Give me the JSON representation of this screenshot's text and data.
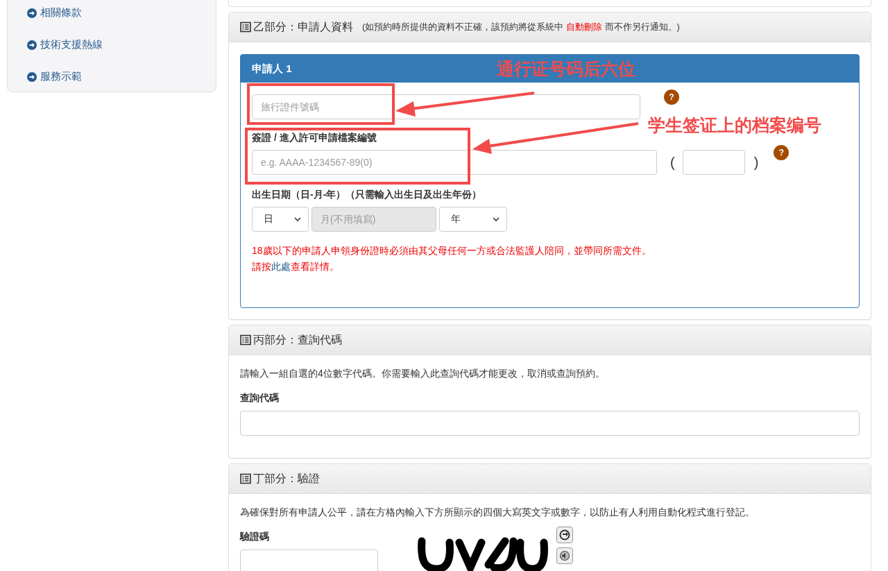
{
  "sidebar": {
    "links": [
      {
        "label": "相關條款"
      },
      {
        "label": "技術支援熱線"
      },
      {
        "label": "服務示範"
      }
    ]
  },
  "section_b": {
    "title": "乙部分：申請人資料",
    "note_before": "(如預約時所提供的資料不正確，該預約將從系統中",
    "note_highlight": "自動刪除",
    "note_after": "而不作另行通知。)",
    "applicant": {
      "title": "申請人 1",
      "travel_doc": {
        "placeholder": "旅行證件號碼",
        "help": "?"
      },
      "visa_label": "簽證 / 進入許可申請檔案編號",
      "visa_field": {
        "placeholder": "e.g. AAAA-1234567-89(0)",
        "help": "?"
      },
      "open_paren": "(",
      "close_paren": ")",
      "dob_label": "出生日期（日-月-年）（只需輸入出生日及出生年份）",
      "day_select": "日",
      "month_field": {
        "placeholder": "月(不用填寫)",
        "disabled": true
      },
      "year_select": "年",
      "warning": "18歲以下的申請人申領身份證時必須由其父母任何一方或合法監護人陪同，並帶同所需文件。",
      "detail_before": "請按",
      "detail_link": "此處",
      "detail_after": "查看詳情。"
    }
  },
  "section_c": {
    "title": "丙部分：查詢代碼",
    "text": "請輸入一組自選的4位數字代碼。你需要輸入此查詢代碼才能更改，取消或查詢預約。",
    "label": "查詢代碼"
  },
  "section_d": {
    "title": "丁部分：驗證",
    "text": "為確保對所有申請人公平，請在方格內輸入下方所顯示的四個大寫英文字或數字，以防止有人利用自動化程式進行登記。",
    "label": "驗證碼"
  },
  "annotations": [
    {
      "text": "通行证号码后六位"
    },
    {
      "text": "学生签证上的档案编号"
    }
  ]
}
